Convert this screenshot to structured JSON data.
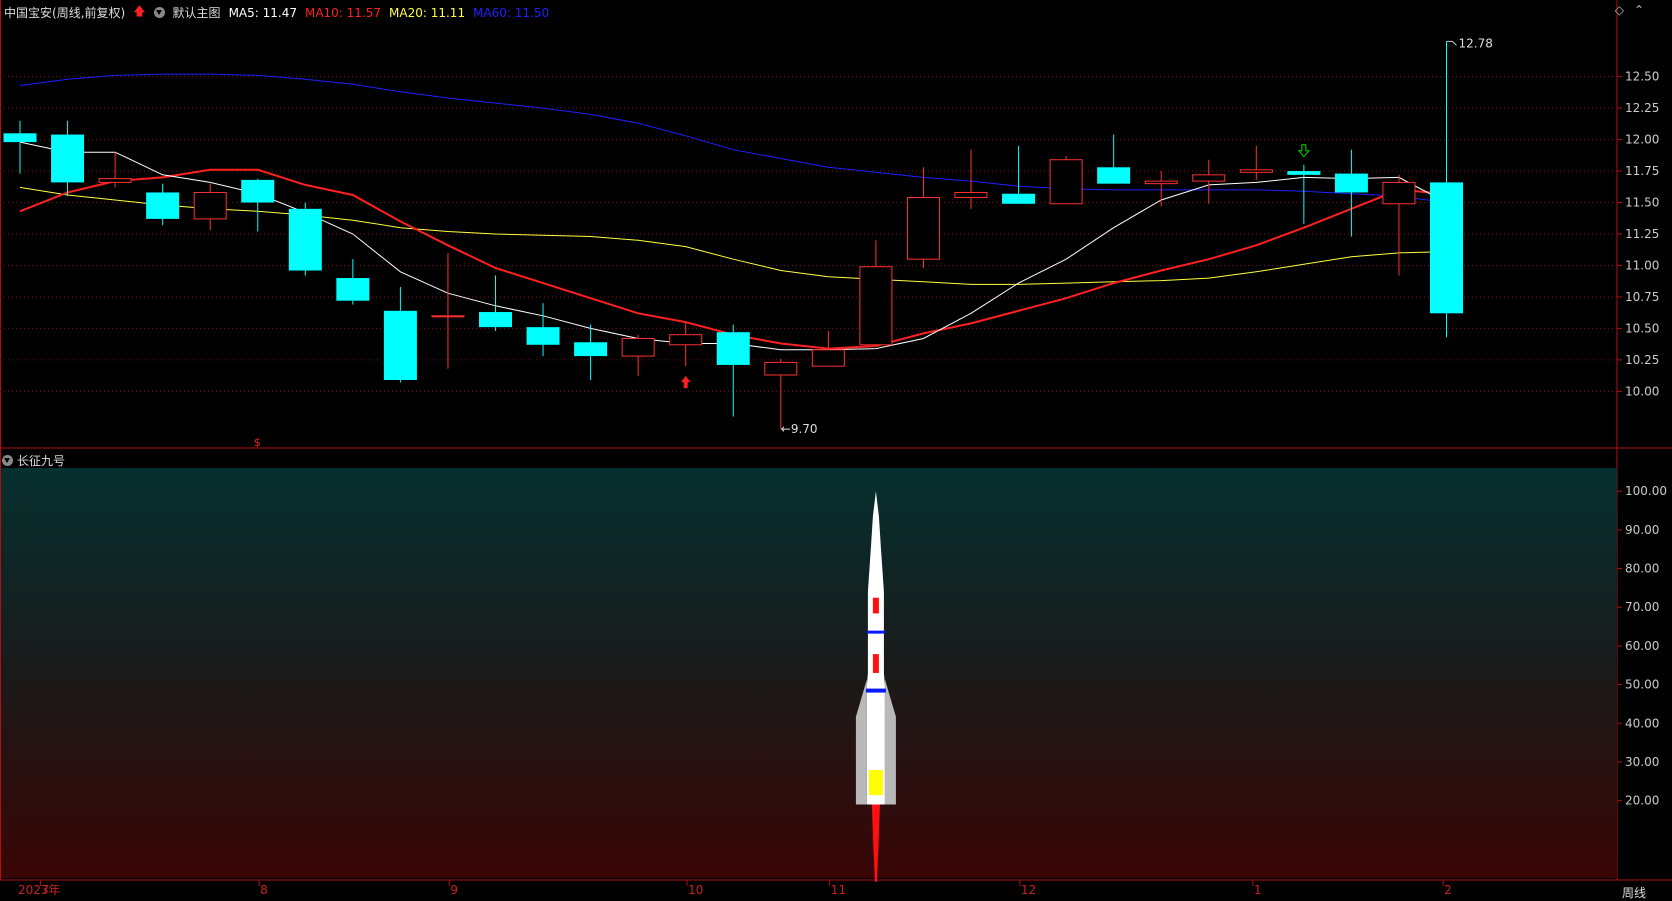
{
  "header": {
    "stock_name": "中国宝安",
    "period_mode": "(周线,前复权)",
    "main_chart_name": "默认主图",
    "indicators": [
      {
        "label": "MA5: 11.47",
        "color": "#ffffff"
      },
      {
        "label": "MA10: 11.57",
        "color": "#ff2020"
      },
      {
        "label": "MA20: 11.11",
        "color": "#ffff40"
      },
      {
        "label": "MA60: 11.50",
        "color": "#2020ff"
      }
    ],
    "window_icons": [
      "◇",
      "⌃"
    ]
  },
  "sub_chart": {
    "name": "长征九号"
  },
  "period_label": "周线",
  "chart_data": [
    {
      "type": "candlestick",
      "price_axis": {
        "ticks": [
          "12.50",
          "12.25",
          "12.00",
          "11.75",
          "11.50",
          "11.25",
          "11.00",
          "10.75",
          "10.50",
          "10.25",
          "10.00"
        ],
        "ylim": [
          9.55,
          12.95
        ]
      },
      "annotations": {
        "high_label": "12.78",
        "low_label": "9.70"
      },
      "candles": [
        {
          "o": 12.05,
          "h": 12.15,
          "l": 11.73,
          "c": 11.98
        },
        {
          "o": 12.04,
          "h": 12.15,
          "l": 11.55,
          "c": 11.66
        },
        {
          "o": 11.66,
          "h": 11.9,
          "l": 11.62,
          "c": 11.69
        },
        {
          "o": 11.58,
          "h": 11.65,
          "l": 11.32,
          "c": 11.37
        },
        {
          "o": 11.37,
          "h": 11.65,
          "l": 11.28,
          "c": 11.58
        },
        {
          "o": 11.68,
          "h": 11.69,
          "l": 11.27,
          "c": 11.5
        },
        {
          "o": 11.45,
          "h": 11.5,
          "l": 10.92,
          "c": 10.96
        },
        {
          "o": 10.9,
          "h": 11.05,
          "l": 10.69,
          "c": 10.72
        },
        {
          "o": 10.64,
          "h": 10.83,
          "l": 10.07,
          "c": 10.09
        },
        {
          "o": 10.6,
          "h": 11.1,
          "l": 10.18,
          "c": 10.6
        },
        {
          "o": 10.63,
          "h": 10.92,
          "l": 10.48,
          "c": 10.51
        },
        {
          "o": 10.51,
          "h": 10.7,
          "l": 10.28,
          "c": 10.37
        },
        {
          "o": 10.39,
          "h": 10.53,
          "l": 10.09,
          "c": 10.28
        },
        {
          "o": 10.28,
          "h": 10.45,
          "l": 10.12,
          "c": 10.42
        },
        {
          "o": 10.37,
          "h": 10.55,
          "l": 10.2,
          "c": 10.45
        },
        {
          "o": 10.47,
          "h": 10.53,
          "l": 9.8,
          "c": 10.21
        },
        {
          "o": 10.13,
          "h": 10.26,
          "l": 9.7,
          "c": 10.23
        },
        {
          "o": 10.2,
          "h": 10.48,
          "l": 10.2,
          "c": 10.33
        },
        {
          "o": 10.37,
          "h": 11.2,
          "l": 10.37,
          "c": 10.99
        },
        {
          "o": 11.05,
          "h": 11.78,
          "l": 10.98,
          "c": 11.54
        },
        {
          "o": 11.54,
          "h": 11.92,
          "l": 11.45,
          "c": 11.58
        },
        {
          "o": 11.57,
          "h": 11.95,
          "l": 11.49,
          "c": 11.49
        },
        {
          "o": 11.49,
          "h": 11.87,
          "l": 11.49,
          "c": 11.84
        },
        {
          "o": 11.78,
          "h": 12.04,
          "l": 11.65,
          "c": 11.65
        },
        {
          "o": 11.65,
          "h": 11.75,
          "l": 11.47,
          "c": 11.67
        },
        {
          "o": 11.67,
          "h": 11.84,
          "l": 11.49,
          "c": 11.72
        },
        {
          "o": 11.74,
          "h": 11.95,
          "l": 11.68,
          "c": 11.76
        },
        {
          "o": 11.75,
          "h": 11.8,
          "l": 11.33,
          "c": 11.72
        },
        {
          "o": 11.73,
          "h": 11.92,
          "l": 11.23,
          "c": 11.58
        },
        {
          "o": 11.49,
          "h": 11.72,
          "l": 10.92,
          "c": 11.66
        },
        {
          "o": 11.66,
          "h": 12.78,
          "l": 10.43,
          "c": 10.62
        }
      ],
      "ma_lines": [
        {
          "name": "MA5",
          "color": "#ffffff",
          "width": 1,
          "values": [
            11.98,
            11.9,
            11.9,
            11.72,
            11.66,
            11.57,
            11.42,
            11.25,
            10.95,
            10.78,
            10.68,
            10.6,
            10.5,
            10.42,
            10.38,
            10.38,
            10.33,
            10.33,
            10.34,
            10.42,
            10.62,
            10.86,
            11.05,
            11.3,
            11.52,
            11.64,
            11.66,
            11.7,
            11.69,
            11.7,
            11.5
          ]
        },
        {
          "name": "MA10",
          "color": "#ff2020",
          "width": 2,
          "values": [
            11.43,
            11.58,
            11.67,
            11.7,
            11.76,
            11.76,
            11.64,
            11.56,
            11.35,
            11.16,
            10.98,
            10.86,
            10.74,
            10.62,
            10.55,
            10.45,
            10.38,
            10.34,
            10.36,
            10.46,
            10.54,
            10.64,
            10.74,
            10.86,
            10.96,
            11.05,
            11.16,
            11.3,
            11.45,
            11.6,
            11.57
          ]
        },
        {
          "name": "MA20",
          "color": "#ffff40",
          "width": 1,
          "values": [
            11.62,
            11.56,
            11.52,
            11.48,
            11.45,
            11.43,
            11.4,
            11.36,
            11.3,
            11.27,
            11.25,
            11.24,
            11.23,
            11.2,
            11.15,
            11.05,
            10.96,
            10.91,
            10.89,
            10.87,
            10.85,
            10.85,
            10.86,
            10.87,
            10.88,
            10.9,
            10.95,
            11.01,
            11.07,
            11.1,
            11.11
          ]
        },
        {
          "name": "MA60",
          "color": "#2020ff",
          "width": 1,
          "values": [
            12.43,
            12.48,
            12.51,
            12.52,
            12.52,
            12.51,
            12.48,
            12.44,
            12.38,
            12.33,
            12.29,
            12.25,
            12.2,
            12.13,
            12.03,
            11.92,
            11.85,
            11.78,
            11.74,
            11.7,
            11.67,
            11.63,
            11.61,
            11.6,
            11.6,
            11.6,
            11.6,
            11.59,
            11.57,
            11.55,
            11.5
          ]
        }
      ],
      "markers": [
        {
          "candle": 14,
          "type": "up-arrow",
          "color": "#ff2020"
        },
        {
          "candle": 27,
          "type": "down-arrow",
          "color": "#00dd00"
        },
        {
          "candle": 5,
          "type": "dollar",
          "color": "#ff2020",
          "label": "$"
        }
      ]
    },
    {
      "type": "indicator",
      "name": "长征九号",
      "ylim": [
        0,
        106
      ],
      "y_ticks": [
        "100.00",
        "90.00",
        "80.00",
        "70.00",
        "60.00",
        "50.00",
        "40.00",
        "30.00",
        "20.00"
      ],
      "rocket": {
        "candle": 18,
        "nose_top": 100,
        "body_bottom": 19,
        "flame_bottom": -1
      }
    },
    {
      "type": "time_axis",
      "labels": [
        {
          "text": "2023年",
          "candle": -1.0
        },
        {
          "text": "7",
          "candle": 0.45
        },
        {
          "text": "8",
          "candle": 5.05
        },
        {
          "text": "9",
          "candle": 9.05
        },
        {
          "text": "10",
          "candle": 14.05
        },
        {
          "text": "11",
          "candle": 17.05
        },
        {
          "text": "12",
          "candle": 21.05
        },
        {
          "text": "1",
          "candle": 25.95
        },
        {
          "text": "2",
          "candle": 29.95
        }
      ]
    }
  ]
}
